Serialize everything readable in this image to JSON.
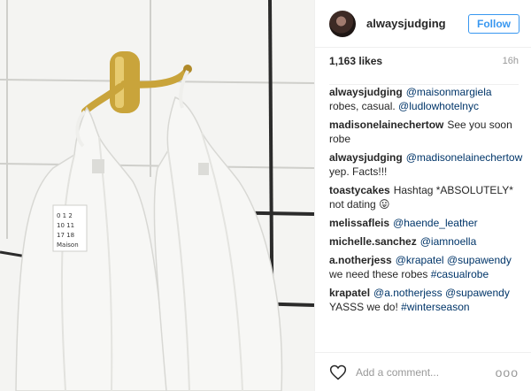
{
  "header": {
    "username": "alwaysjudging",
    "follow_label": "Follow"
  },
  "meta": {
    "likes": "1,163 likes",
    "time": "16h"
  },
  "comments": [
    {
      "user": "alwaysjudging",
      "parts": [
        {
          "t": "@maisonmargiela",
          "k": "mention"
        },
        {
          "t": " robes, casual. ",
          "k": "text"
        },
        {
          "t": "@ludlowhotelnyc",
          "k": "mention"
        }
      ]
    },
    {
      "user": "madisonelainechertow",
      "parts": [
        {
          "t": "See you soon robe",
          "k": "text"
        }
      ]
    },
    {
      "user": "alwaysjudging",
      "parts": [
        {
          "t": "@madisonelainechertow",
          "k": "mention"
        },
        {
          "t": " yep. Facts!!!",
          "k": "text"
        }
      ]
    },
    {
      "user": "toastycakes",
      "parts": [
        {
          "t": "Hashtag *ABSOLUTELY* not dating 😛",
          "k": "text"
        }
      ]
    },
    {
      "user": "melissafleis",
      "parts": [
        {
          "t": "@haende_leather",
          "k": "mention"
        }
      ]
    },
    {
      "user": "michelle.sanchez",
      "parts": [
        {
          "t": "@iamnoella",
          "k": "mention"
        }
      ]
    },
    {
      "user": "a.notherjess",
      "parts": [
        {
          "t": "@krapatel",
          "k": "mention"
        },
        {
          "t": " ",
          "k": "text"
        },
        {
          "t": "@supawendy",
          "k": "mention"
        },
        {
          "t": " we need these robes ",
          "k": "text"
        },
        {
          "t": "#casualrobe",
          "k": "tag"
        }
      ]
    },
    {
      "user": "krapatel",
      "parts": [
        {
          "t": "@a.notherjess",
          "k": "mention"
        },
        {
          "t": " ",
          "k": "text"
        },
        {
          "t": "@supawendy",
          "k": "mention"
        },
        {
          "t": " YASSS we do! ",
          "k": "text"
        },
        {
          "t": "#winterseason",
          "k": "tag"
        }
      ]
    }
  ],
  "photo": {
    "label_text": "0 1 2 / 10 11 / 17 18 / Maison",
    "colors": {
      "tile": "#f4f4f2",
      "grout": "#2b2b2b",
      "brass": "#c9a43b",
      "robe": "#f7f7f5"
    }
  },
  "footer": {
    "comment_placeholder": "Add a comment...",
    "heart_icon": "heart-icon",
    "more_label": "ooo"
  },
  "colors": {
    "accent": "#3897f0",
    "link": "#003569",
    "muted": "#999999"
  }
}
